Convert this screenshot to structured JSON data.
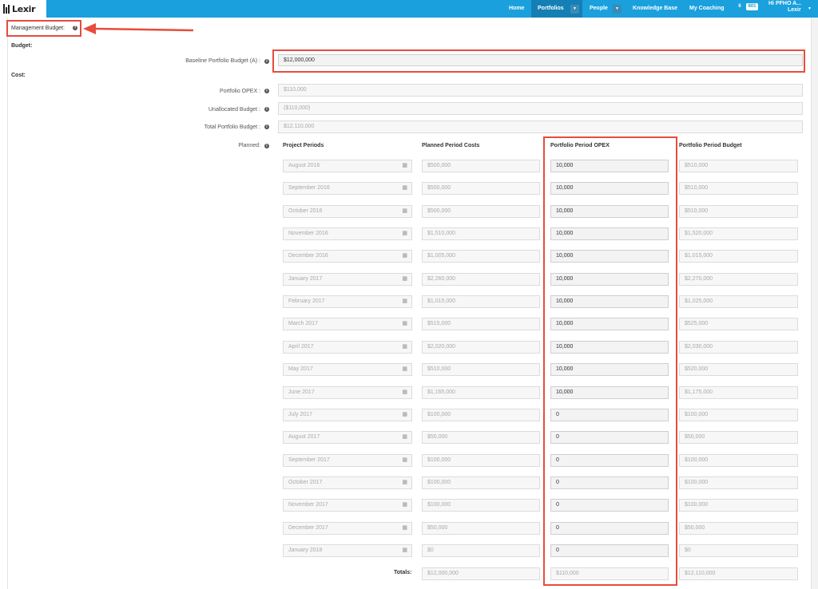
{
  "nav": {
    "logo_text": "Lexir",
    "items": [
      "Home",
      "Portfolios",
      "People",
      "Knowledge Base",
      "My Coaching"
    ],
    "badge_left": "6",
    "badge_right": "801",
    "user_greeting": "Hi PFHO A...",
    "user_name": "Lexir"
  },
  "management_budget": {
    "label": "Management Budget:"
  },
  "sections": {
    "budget": "Budget:",
    "cost": "Cost:"
  },
  "fields": {
    "baseline_label": "Baseline Portfolio Budget (A) :",
    "baseline_value": "$12,000,000",
    "opex_label": "Portfolio OPEX :",
    "opex_value": "$110,000",
    "unallocated_label": "Unallocated Budget :",
    "unallocated_value": "($110,000)",
    "total_label": "Total Portfolio Budget :",
    "total_value": "$12,110,000",
    "planned_label": "Planned:"
  },
  "table": {
    "headers": [
      "Project Periods",
      "Planned Period Costs",
      "Portfolio Period OPEX",
      "Portfolio Period Budget"
    ],
    "rows": [
      {
        "period": "August 2016",
        "cost": "$500,000",
        "opex": "10,000",
        "budget": "$510,000"
      },
      {
        "period": "September 2016",
        "cost": "$500,000",
        "opex": "10,000",
        "budget": "$510,000"
      },
      {
        "period": "October 2016",
        "cost": "$500,000",
        "opex": "10,000",
        "budget": "$510,000"
      },
      {
        "period": "November 2016",
        "cost": "$1,510,000",
        "opex": "10,000",
        "budget": "$1,520,000"
      },
      {
        "period": "December 2016",
        "cost": "$1,005,000",
        "opex": "10,000",
        "budget": "$1,015,000"
      },
      {
        "period": "January 2017",
        "cost": "$2,260,000",
        "opex": "10,000",
        "budget": "$2,270,000"
      },
      {
        "period": "February 2017",
        "cost": "$1,015,000",
        "opex": "10,000",
        "budget": "$1,025,000"
      },
      {
        "period": "March 2017",
        "cost": "$515,000",
        "opex": "10,000",
        "budget": "$525,000"
      },
      {
        "period": "April 2017",
        "cost": "$2,020,000",
        "opex": "10,000",
        "budget": "$2,030,000"
      },
      {
        "period": "May 2017",
        "cost": "$510,000",
        "opex": "10,000",
        "budget": "$520,000"
      },
      {
        "period": "June 2017",
        "cost": "$1,165,000",
        "opex": "10,000",
        "budget": "$1,175,000"
      },
      {
        "period": "July 2017",
        "cost": "$100,000",
        "opex": "0",
        "budget": "$100,000"
      },
      {
        "period": "August 2017",
        "cost": "$50,000",
        "opex": "0",
        "budget": "$50,000"
      },
      {
        "period": "September 2017",
        "cost": "$100,000",
        "opex": "0",
        "budget": "$100,000"
      },
      {
        "period": "October 2017",
        "cost": "$100,000",
        "opex": "0",
        "budget": "$100,000"
      },
      {
        "period": "November 2017",
        "cost": "$100,000",
        "opex": "0",
        "budget": "$100,000"
      },
      {
        "period": "December 2017",
        "cost": "$50,000",
        "opex": "0",
        "budget": "$50,000"
      },
      {
        "period": "January 2018",
        "cost": "$0",
        "opex": "0",
        "budget": "$0"
      }
    ],
    "totals_label": "Totals:",
    "totals": {
      "cost": "$12,000,000",
      "opex": "$110,000",
      "budget": "$12,110,000"
    }
  },
  "colors": {
    "nav": "#1aa0dc",
    "nav_active": "#147fb4",
    "annotation": "#e74c3c"
  }
}
